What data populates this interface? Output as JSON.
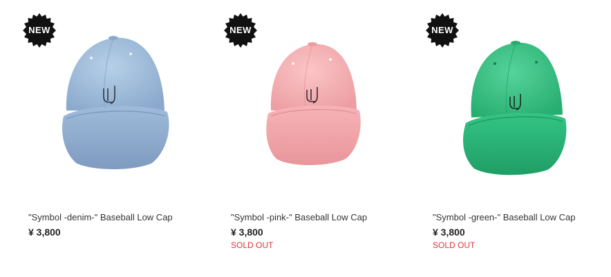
{
  "products": [
    {
      "badge": "NEW",
      "title": "\"Symbol -denim-\" Baseball Low Cap",
      "price": "¥ 3,800",
      "status": "",
      "image": "denim-cap-image",
      "colors": {
        "crown": "#a6c2de",
        "crown_dark": "#86a6c9",
        "brim": "#9cb8d8",
        "brim_dark": "#7f9dc0"
      }
    },
    {
      "badge": "NEW",
      "title": "\"Symbol -pink-\" Baseball Low Cap",
      "price": "¥ 3,800",
      "status": "SOLD OUT",
      "image": "pink-cap-image",
      "colors": {
        "crown": "#f6b4b7",
        "crown_dark": "#e99ea2",
        "brim": "#f5a9ad",
        "brim_dark": "#e38f94"
      }
    },
    {
      "badge": "NEW",
      "title": "\"Symbol -green-\" Baseball Low Cap",
      "price": "¥ 3,800",
      "status": "SOLD OUT",
      "image": "green-cap-image",
      "colors": {
        "crown": "#3fca8b",
        "crown_dark": "#2fb57a",
        "brim": "#2cbd7d",
        "brim_dark": "#1f9e66"
      }
    }
  ],
  "accent": {
    "soldout": "#e0333a",
    "badge": "#111111"
  }
}
